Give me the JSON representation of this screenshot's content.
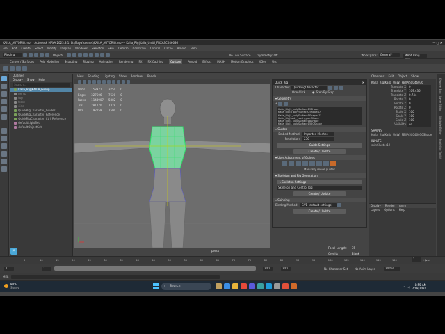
{
  "window": {
    "title": "KAILA_AUTORIG.mb* - Autodesk MAYA 2023.3.1: D:\\Maya\\scenes\\KAILA_AUTORIG.mb --- Kaila_Rig|Kaila_UnWi_FBXASC046036"
  },
  "menubar": [
    "File",
    "Edit",
    "Create",
    "Select",
    "Modify",
    "Display",
    "Windows",
    "Skeleton",
    "Skin",
    "Deform",
    "Constrain",
    "Control",
    "Cache",
    "Arnold",
    "Help"
  ],
  "menuset": "Rigging",
  "statusline": {
    "objects_label": "Objects",
    "no_live_surface": "No Live Surface",
    "symmetry": "Symmetry: Off",
    "workspace_label": "Workspace:",
    "workspace": "General*",
    "sign_in": "MAYA Fang Rein"
  },
  "shelf_tabs": [
    "Curves / Surfaces",
    "Poly Modeling",
    "Sculpting",
    "Rigging",
    "Animation",
    "Rendering",
    "FX",
    "FX Caching",
    "Custom",
    "Arnold",
    "Bifrost",
    "MASH",
    "Motion Graphics",
    "XGen",
    "Usd"
  ],
  "shelf_active": "Custom",
  "outliner": {
    "title": "Outliner",
    "menu": [
      "Display",
      "Show",
      "Help"
    ],
    "search_placeholder": "Search...",
    "items": [
      {
        "label": "Kaila_Rig|KAILA_Group",
        "state": "selected"
      },
      {
        "label": "persp",
        "state": "dim"
      },
      {
        "label": "top",
        "state": "dim"
      },
      {
        "label": "front",
        "state": "dim"
      },
      {
        "label": "side",
        "state": "dim"
      },
      {
        "label": "QuickRigCharacter_Guides",
        "state": "normal"
      },
      {
        "label": "QuickRigCharacter_Reference",
        "state": "normal"
      },
      {
        "label": "QuickRigCharacter_Ctrl_Reference",
        "state": "normal"
      },
      {
        "label": "defaultLightSet",
        "state": "normal"
      },
      {
        "label": "defaultObjectSet",
        "state": "normal"
      }
    ]
  },
  "viewport": {
    "menu": [
      "View",
      "Shading",
      "Lighting",
      "Show",
      "Renderer",
      "Panels"
    ],
    "hud_rows": [
      [
        "Verts",
        "158971",
        "3750",
        "0"
      ],
      [
        "Edges",
        "327606",
        "7620",
        "0"
      ],
      [
        "Faces",
        "1144907",
        "5882",
        "0"
      ],
      [
        "Tris",
        "281270",
        "7328",
        "0"
      ],
      [
        "UVs",
        "192059",
        "7500",
        "0"
      ]
    ],
    "camera": "persp",
    "hud_bottom": [
      [
        "Focal Length:",
        "35"
      ],
      [
        "Credits",
        "Blank"
      ]
    ]
  },
  "quickrig": {
    "title": "Quick Rig",
    "character_label": "Character:",
    "character": "QuickRigCharacter",
    "mode_one_click": "One-Click",
    "mode_step": "Step-By-Step",
    "geometry_section": "Geometry",
    "geometry_list": [
      "Kaila_Rig|L_polySurface19Shape",
      "Kaila_Rig|R_polySurface2Shape47",
      "Kaila_Rig|L_polySurface1Shape47",
      "Kaila_Rig|body_teeth_gumShape",
      "Kaila_Rig|L_polySurface18Shape",
      "Kaila_Rig|L_polySurface1520Shape"
    ],
    "guides_section": "Guides",
    "embed_method_label": "Embed Method:",
    "embed_method": "Imported Meshes",
    "resolution_label": "Resolution:",
    "resolution": "256",
    "guide_settings": "Guide Settings",
    "create_update_1": "Create / Update",
    "user_adjust_section": "User Adjustment of Guides",
    "manually_move": "Manually move guides",
    "skeleton_section": "Skeleton and Rig Generation",
    "skeleton_settings": "Skeleton Settings",
    "skeleton_dropdown": "Skeleton and Control Rig",
    "create_update_2": "Create / Update",
    "skinning_section": "Skinning",
    "binding_method_label": "Binding Method:",
    "binding_method": "GVB (default settings)",
    "create_update_3": "Create / Update"
  },
  "channelbox": {
    "menu": [
      "Channels",
      "Edit",
      "Object",
      "Show"
    ],
    "object": "Kaila_Rig|Kaila_UnWi_FBXASC046036",
    "channels": [
      [
        "Translate X",
        "0"
      ],
      [
        "Translate Y",
        "109.436"
      ],
      [
        "Translate Z",
        "0.744"
      ],
      [
        "Rotate X",
        "0"
      ],
      [
        "Rotate Y",
        "0"
      ],
      [
        "Rotate Z",
        "0"
      ],
      [
        "Scale X",
        "100"
      ],
      [
        "Scale Y",
        "100"
      ],
      [
        "Scale Z",
        "100"
      ],
      [
        "Visibility",
        "on"
      ]
    ],
    "shapes_label": "SHAPES",
    "shape_name": "Kaila_Rig|Kaila_UnWi_FBXASC046036Shape",
    "inputs_label": "INPUTS",
    "input_name": "skinCluster19"
  },
  "layers": {
    "tabs": [
      "Display",
      "Render",
      "Anim"
    ],
    "menu": [
      "Layers",
      "Options",
      "Help"
    ]
  },
  "sidetabs": [
    "Channel Box / Layer Editor",
    "Attribute Editor",
    "Modeling Toolkit"
  ],
  "timeline": {
    "ticks": [
      "5",
      "10",
      "15",
      "20",
      "25",
      "30",
      "35",
      "40",
      "45",
      "50",
      "55",
      "60",
      "65",
      "70",
      "75",
      "80",
      "85",
      "90",
      "95",
      "100",
      "105",
      "110",
      "115",
      "120"
    ],
    "current_frame": "1",
    "range_start": "1",
    "range_start_inner": "1",
    "range_end_inner": "200",
    "range_end": "200",
    "character_set": "No Character Set",
    "anim_layer": "No Anim Layer",
    "fps": "24 fps"
  },
  "cmdline": {
    "lang": "MEL"
  },
  "taskbar": {
    "weather_temp": "80°F",
    "weather_desc": "Sunny",
    "search_placeholder": "Search",
    "clock_time": "8:55 AM",
    "clock_date": "7/18/2024"
  }
}
